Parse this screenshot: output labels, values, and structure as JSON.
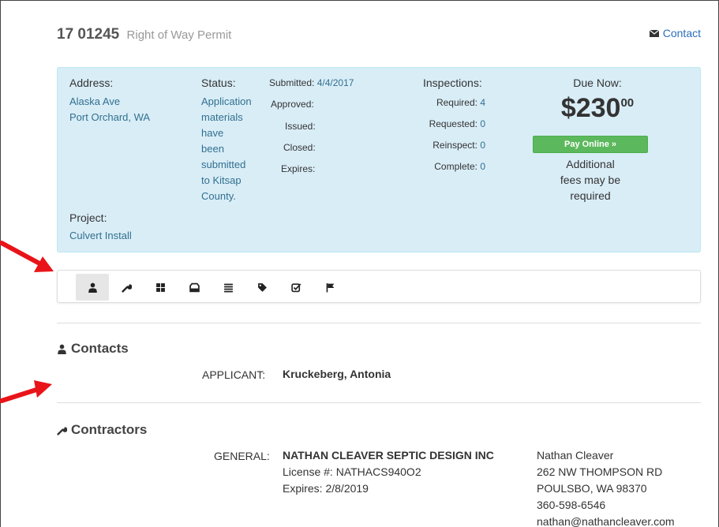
{
  "header": {
    "permit_number": "17 01245",
    "permit_type": "Right of Way Permit",
    "contact_label": "Contact"
  },
  "info": {
    "address_label": "Address:",
    "address_line1": "Alaska Ave",
    "address_line2": "Port Orchard,  WA",
    "project_label": "Project:",
    "project_value": "Culvert Install",
    "status_label": "Status:",
    "status_lines": [
      "Application",
      "materials",
      "have",
      "been",
      "submitted",
      "to Kitsap",
      "County."
    ],
    "dates": {
      "submitted_label": "Submitted:",
      "submitted_value": "4/4/2017",
      "approved_label": "Approved:",
      "issued_label": "Issued:",
      "closed_label": "Closed:",
      "expires_label": "Expires:"
    },
    "inspections": {
      "title": "Inspections:",
      "required_label": "Required:",
      "required_value": "4",
      "requested_label": "Requested:",
      "requested_value": "0",
      "reinspect_label": "Reinspect:",
      "reinspect_value": "0",
      "complete_label": "Complete:",
      "complete_value": "0"
    },
    "due": {
      "label": "Due Now:",
      "amount_main": "$230",
      "amount_cents": "00",
      "pay_button": "Pay Online »",
      "note_lines": [
        "Additional",
        "fees may be",
        "required"
      ]
    }
  },
  "toolbar": {
    "icons": [
      "user-icon",
      "wrench-icon",
      "grid-icon",
      "inbox-icon",
      "list-icon",
      "tag-icon",
      "check-icon",
      "flag-icon"
    ]
  },
  "contacts": {
    "title": "Contacts",
    "role": "APPLICANT:",
    "name": "Kruckeberg, Antonia"
  },
  "contractors": {
    "title": "Contractors",
    "role": "GENERAL:",
    "company": "NATHAN CLEAVER SEPTIC DESIGN INC",
    "license": "License #: NATHACS940O2",
    "expires": "Expires: 2/8/2019",
    "person": "Nathan Cleaver",
    "street": "262 NW THOMPSON RD",
    "city": "POULSBO, WA 98370",
    "phone": "360-598-6546",
    "email": "nathan@nathancleaver.com"
  },
  "colors": {
    "panel_bg": "#d9edf7",
    "link": "#2a6ebb",
    "pay_button": "#5cb85c",
    "arrow": "#e8141a"
  }
}
